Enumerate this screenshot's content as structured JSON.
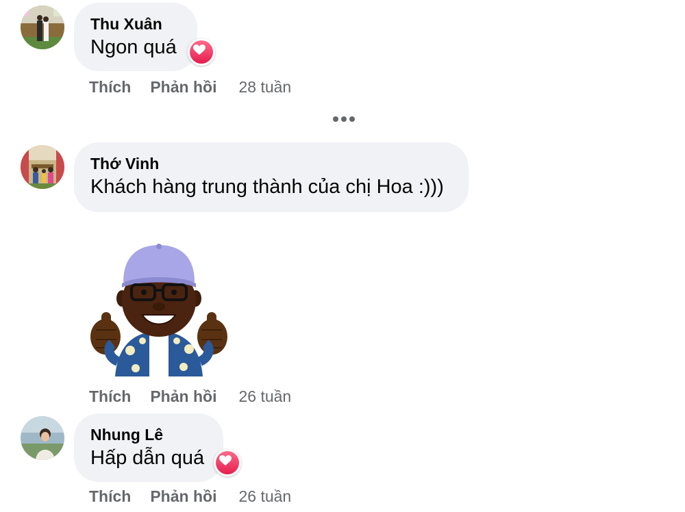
{
  "comments": [
    {
      "author": "Thu Xuân",
      "text": "Ngon quá",
      "reaction": "heart-icon",
      "like_label": "Thích",
      "reply_label": "Phản hồi",
      "time": "28 tuần"
    },
    {
      "author": "Thớ Vinh",
      "text": "Khách hàng trung thành của chị Hoa :)))",
      "sticker": "thumbs-up-avatar-sticker",
      "like_label": "Thích",
      "reply_label": "Phản hồi",
      "time": "26 tuần"
    },
    {
      "author": "Nhung Lê",
      "text": "Hấp dẫn quá",
      "reaction": "heart-icon",
      "like_label": "Thích",
      "reply_label": "Phản hồi",
      "time": "26 tuần"
    }
  ],
  "more_replies_icon": "more-dots-icon",
  "colors": {
    "bubble": "#f0f2f5",
    "action_text": "#65676b",
    "heart": "#e41e4d"
  }
}
